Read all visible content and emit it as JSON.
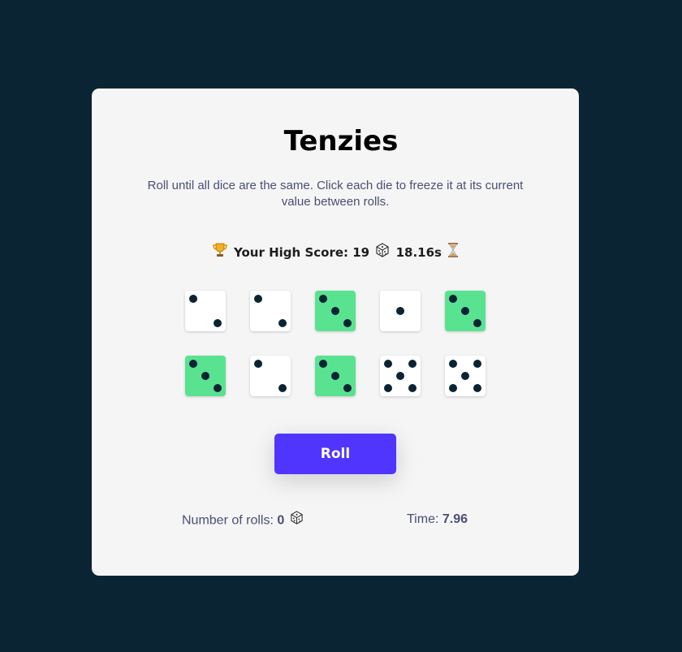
{
  "app": {
    "title": "Tenzies",
    "instructions": "Roll until all dice are the same. Click each die to freeze it at its current value between rolls."
  },
  "high_score": {
    "label": "Your High Score:",
    "rolls": "19",
    "time": "18.16s",
    "trophy_icon": "trophy-icon",
    "dice_icon": "dice-icon",
    "hourglass_icon": "hourglass-icon"
  },
  "dice": [
    {
      "value": 2,
      "held": false
    },
    {
      "value": 2,
      "held": false
    },
    {
      "value": 3,
      "held": true
    },
    {
      "value": 1,
      "held": false
    },
    {
      "value": 3,
      "held": true
    },
    {
      "value": 3,
      "held": true
    },
    {
      "value": 2,
      "held": false
    },
    {
      "value": 3,
      "held": true
    },
    {
      "value": 5,
      "held": false
    },
    {
      "value": 5,
      "held": false
    }
  ],
  "colors": {
    "background": "#0b2434",
    "card": "#f5f5f5",
    "held_die": "#59e391",
    "die": "#ffffff",
    "pip": "#0b2434",
    "button": "#5035ff",
    "muted_text": "#4a4e74"
  },
  "roll_button": {
    "label": "Roll"
  },
  "stats": {
    "rolls_label": "Number of rolls:",
    "rolls_value": "0",
    "time_label": "Time:",
    "time_value": "7.96"
  }
}
